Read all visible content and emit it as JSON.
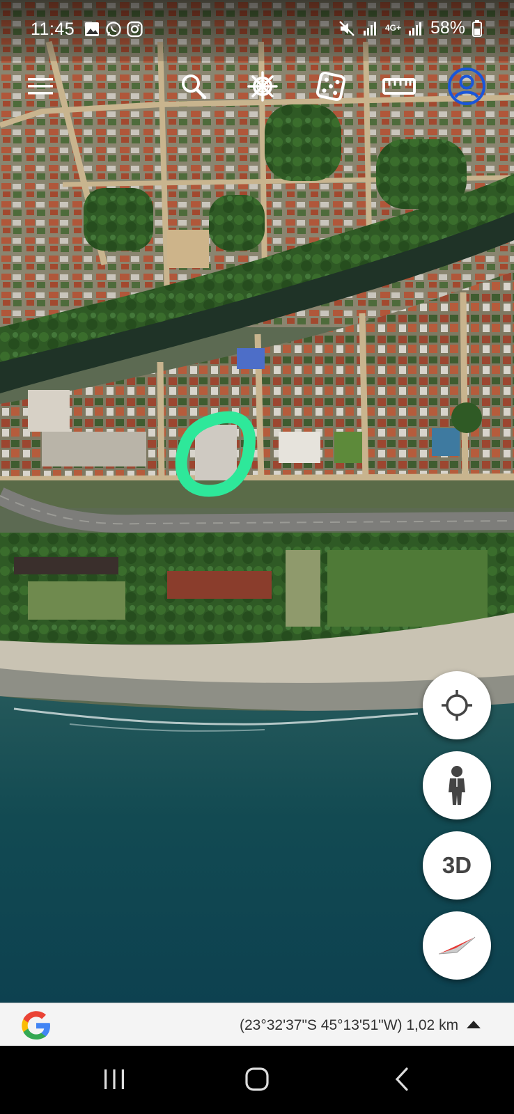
{
  "status_bar": {
    "time": "11:45",
    "network": "4G+",
    "battery": "58%"
  },
  "toolbar": {
    "items": [
      {
        "name": "menu-icon"
      },
      {
        "name": "search-icon"
      },
      {
        "name": "voyager-wheel-icon"
      },
      {
        "name": "dice-icon"
      },
      {
        "name": "ruler-icon"
      },
      {
        "name": "account-icon"
      }
    ]
  },
  "map": {
    "type": "satellite",
    "highlight_color": "#2ee89a"
  },
  "fabs": {
    "location": "crosshair-icon",
    "street_view": "pegman-icon",
    "view_mode_label": "3D",
    "compass": "compass-icon"
  },
  "info_bar": {
    "coordinates": "(23°32'37\"S 45°13'51\"W) 1,02 km"
  },
  "nav_bar": {
    "items": [
      "recent-apps-icon",
      "home-icon",
      "back-icon"
    ]
  },
  "colors": {
    "accent": "#1a56d9",
    "highlight": "#2ee89a",
    "compass_red": "#e53935"
  }
}
